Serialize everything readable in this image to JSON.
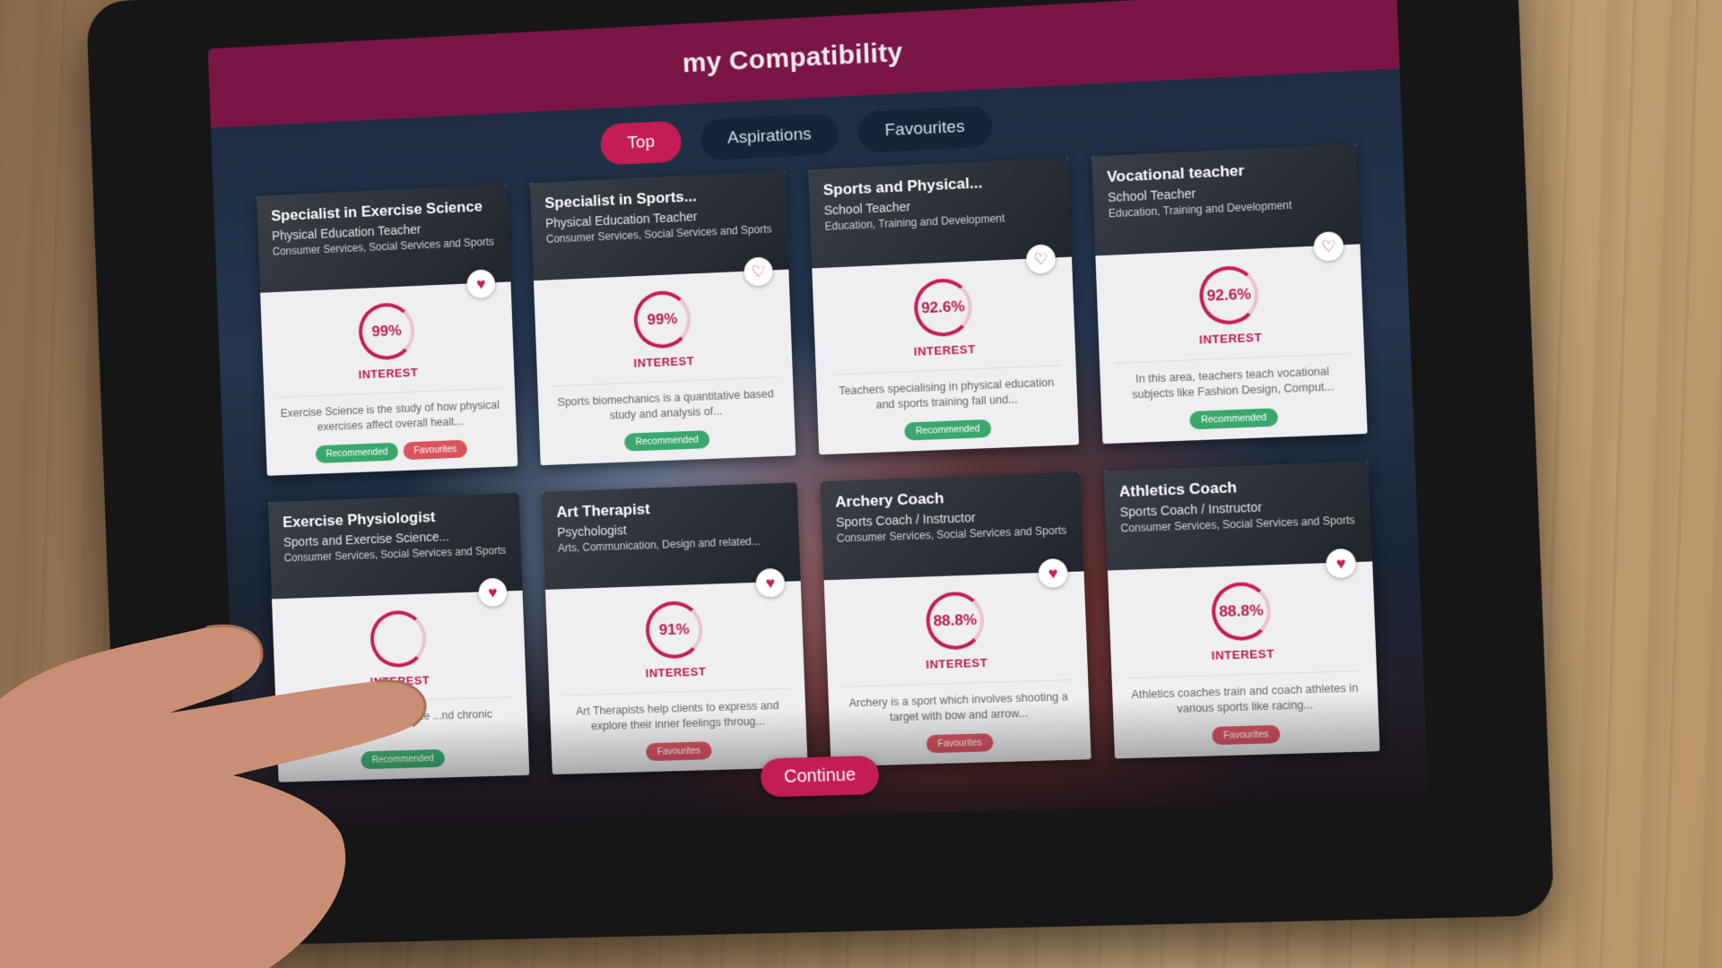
{
  "app": {
    "title": "my Compatibility"
  },
  "tabs": [
    {
      "label": "Top",
      "active": true
    },
    {
      "label": "Aspirations",
      "active": false
    },
    {
      "label": "Favourites",
      "active": false
    }
  ],
  "interest_label": "INTEREST",
  "badges": {
    "recommended": "Recommended",
    "favourites": "Favourites"
  },
  "cards": [
    {
      "title": "Specialist in Exercise Science",
      "subtitle": "Physical Education Teacher",
      "category": "Consumer Services, Social Services and Sports",
      "score": "99%",
      "description": "Exercise Science is the study of how physical exercises affect overall healt...",
      "favourited": true,
      "recommended": true,
      "favourite_badge": true
    },
    {
      "title": "Specialist in Sports...",
      "subtitle": "Physical Education Teacher",
      "category": "Consumer Services, Social Services and Sports",
      "score": "99%",
      "description": "Sports biomechanics is a quantitative based study and analysis of...",
      "favourited": false,
      "recommended": true,
      "favourite_badge": false
    },
    {
      "title": "Sports and Physical...",
      "subtitle": "School Teacher",
      "category": "Education, Training and Development",
      "score": "92.6%",
      "description": "Teachers specialising in physical education and sports training fall und...",
      "favourited": false,
      "recommended": true,
      "favourite_badge": false
    },
    {
      "title": "Vocational teacher",
      "subtitle": "School Teacher",
      "category": "Education, Training and Development",
      "score": "92.6%",
      "description": "In this area, teachers teach vocational subjects like Fashion Design, Comput...",
      "favourited": false,
      "recommended": true,
      "favourite_badge": false
    },
    {
      "title": "Exercise Physiologist",
      "subtitle": "Sports and Exercise Science...",
      "category": "Consumer Services, Social Services and Sports",
      "score": "",
      "description": "Exercis... he study of the ...nd chronic",
      "favourited": true,
      "recommended": true,
      "favourite_badge": false
    },
    {
      "title": "Art Therapist",
      "subtitle": "Psychologist",
      "category": "Arts, Communication, Design and related...",
      "score": "91%",
      "description": "Art Therapists help clients to express and explore their inner feelings throug...",
      "favourited": true,
      "recommended": false,
      "favourite_badge": true
    },
    {
      "title": "Archery Coach",
      "subtitle": "Sports Coach / Instructor",
      "category": "Consumer Services, Social Services and Sports",
      "score": "88.8%",
      "description": "Archery is a sport which involves shooting a target with bow and arrow...",
      "favourited": true,
      "recommended": false,
      "favourite_badge": true
    },
    {
      "title": "Athletics Coach",
      "subtitle": "Sports Coach / Instructor",
      "category": "Consumer Services, Social Services and Sports",
      "score": "88.8%",
      "description": "Athletics coaches train and coach athletes in various sports like racing...",
      "favourited": true,
      "recommended": false,
      "favourite_badge": true
    }
  ],
  "continue_label": "Continue",
  "icons": {
    "heart_filled": "heart-filled-icon",
    "heart_outline": "heart-outline-icon"
  },
  "colors": {
    "header": "#7a1646",
    "accent": "#c41d55",
    "recommended": "#3aa76d",
    "favourite": "#d9535f"
  }
}
